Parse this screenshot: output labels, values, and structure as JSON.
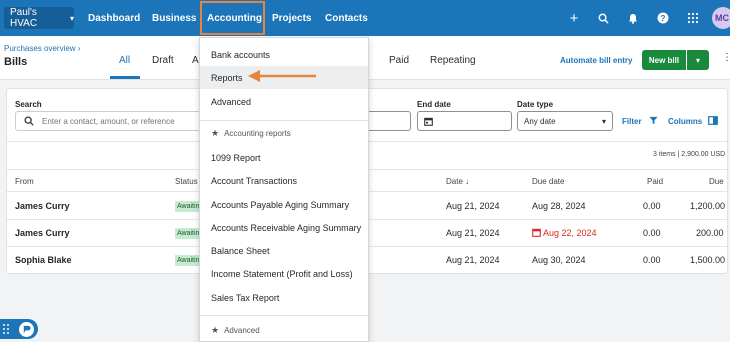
{
  "topnav": {
    "org_label": "Paul's HVAC",
    "items": [
      "Dashboard",
      "Business",
      "Accounting",
      "Projects",
      "Contacts"
    ],
    "avatar_initials": "MC"
  },
  "header": {
    "breadcrumb": "Purchases overview",
    "title": "Bills",
    "tabs": [
      "All",
      "Draft",
      "A",
      "Paid",
      "Repeating"
    ],
    "auto_bill_label": "Automate bill entry",
    "new_bill_label": "New bill"
  },
  "filters": {
    "search_label": "Search",
    "search_placeholder": "Enter a contact, amount, or reference",
    "end_date_label": "End date",
    "date_type_label": "Date type",
    "date_type_value": "Any date",
    "filter_label": "Filter",
    "columns_label": "Columns"
  },
  "summary": "3 items | 2,900.00 USD",
  "table": {
    "headers": [
      "From",
      "Status",
      "Date",
      "Due date",
      "Paid",
      "Due"
    ],
    "rows": [
      {
        "from": "James Curry",
        "status": "Awaiting",
        "date": "Aug 21, 2024",
        "due_date": "Aug 28, 2024",
        "paid": "0.00",
        "due": "1,200.00"
      },
      {
        "from": "James Curry",
        "status": "Awaiting",
        "date": "Aug 21, 2024",
        "due_date": "Aug 22, 2024",
        "paid": "0.00",
        "due": "200.00"
      },
      {
        "from": "Sophia Blake",
        "status": "Awaiting",
        "date": "Aug 21, 2024",
        "due_date": "Aug 30, 2024",
        "paid": "0.00",
        "due": "1,500.00"
      }
    ]
  },
  "menu": {
    "items": [
      "Bank accounts",
      "Reports",
      "Advanced"
    ],
    "group_label": "Accounting reports",
    "reports": [
      "1099 Report",
      "Account Transactions",
      "Accounts Payable Aging Summary",
      "Accounts Receivable Aging Summary",
      "Balance Sheet",
      "Income Statement (Profit and Loss)",
      "Sales Tax Report"
    ],
    "group2_label": "Advanced"
  },
  "colors": {
    "brand": "#1c74b9",
    "highlight": "#e8833a",
    "new_bill": "#198a3c",
    "overdue": "#d52b1e"
  }
}
